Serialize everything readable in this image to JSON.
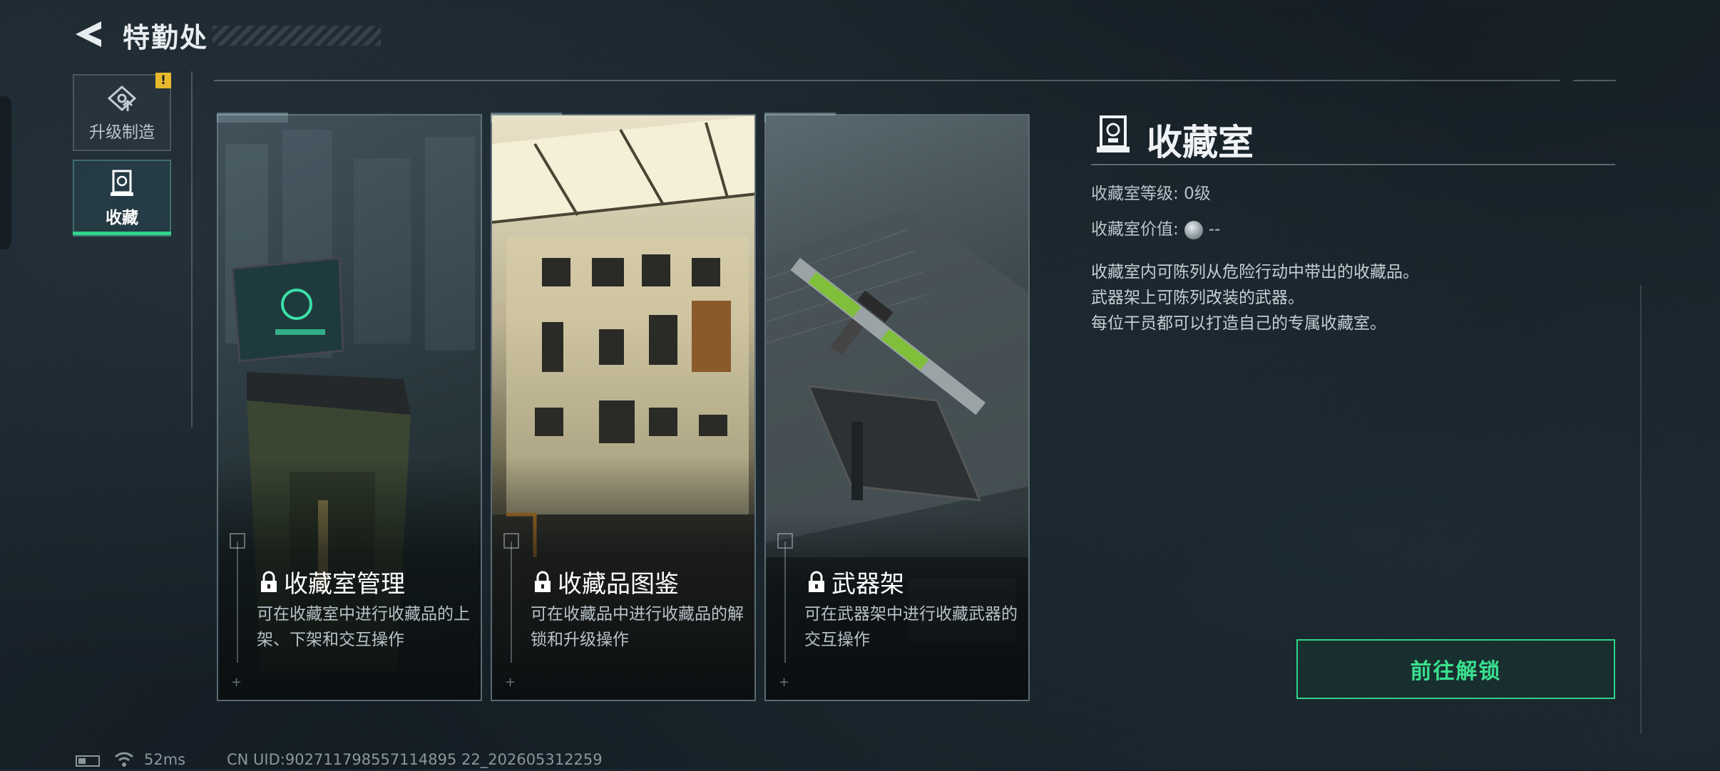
{
  "header": {
    "title": "特勤处"
  },
  "sidebar": {
    "items": [
      {
        "label": "升级制造",
        "badge": "!"
      },
      {
        "label": "收藏"
      }
    ]
  },
  "cards": [
    {
      "title": "收藏室管理",
      "desc": "可在收藏室中进行收藏品的上架、下架和交互操作"
    },
    {
      "title": "收藏品图鉴",
      "desc": "可在收藏品中进行收藏品的解锁和升级操作"
    },
    {
      "title": "武器架",
      "desc": "可在武器架中进行收藏武器的交互操作"
    }
  ],
  "info": {
    "title": "收藏室",
    "level_label": "收藏室等级:",
    "level_value": "0级",
    "worth_label": "收藏室价值:",
    "worth_value": "--",
    "desc_lines": [
      "收藏室内可陈列从危险行动中带出的收藏品。",
      "武器架上可陈列改装的武器。",
      "每位干员都可以打造自己的专属收藏室。"
    ]
  },
  "unlock_button": {
    "label": "前往解锁"
  },
  "footer": {
    "ping": "52ms",
    "uid": "CN UID:902711798557114895 22_202605312259"
  },
  "colors": {
    "accent": "#2fd48a",
    "badge": "#e8b92d",
    "background": "#18222a"
  }
}
